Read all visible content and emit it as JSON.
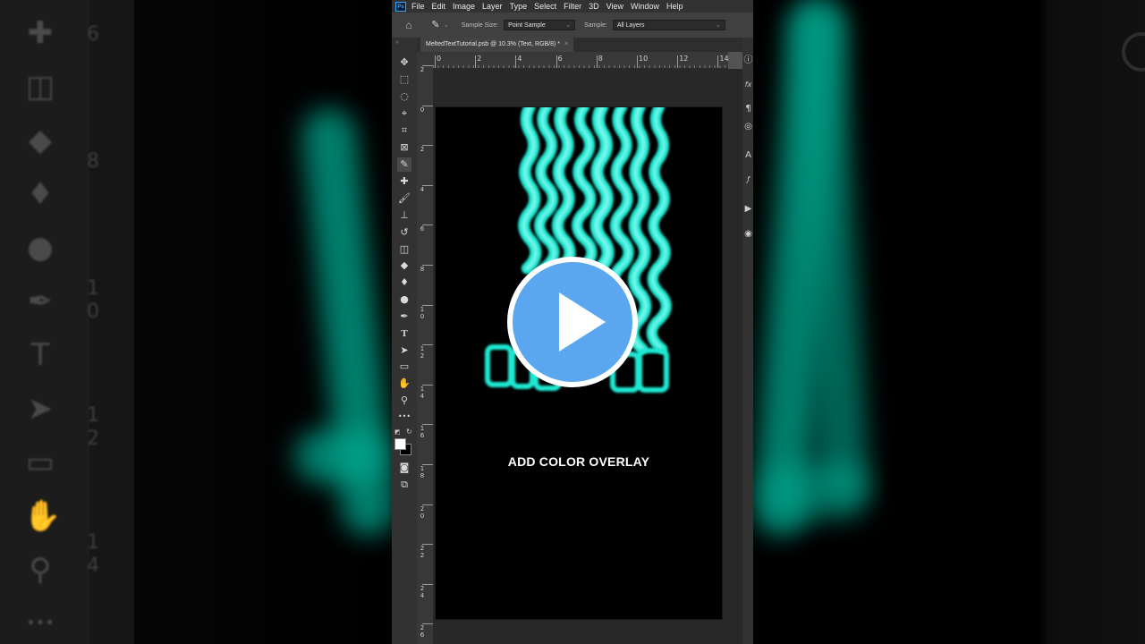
{
  "menu": {
    "logo": "Ps",
    "items": [
      "File",
      "Edit",
      "Image",
      "Layer",
      "Type",
      "Select",
      "Filter",
      "3D",
      "View",
      "Window",
      "Help"
    ]
  },
  "options_bar": {
    "home_icon": "home-icon",
    "tool_icon": "eyedropper-icon",
    "sample_size_label": "Sample Size:",
    "sample_size_value": "Point Sample",
    "sample_label": "Sample:",
    "sample_value": "All Layers"
  },
  "document": {
    "tab_title": "MeltedTextTutorial.psb @ 10.3% (Text, RGB/8) *",
    "close": "×"
  },
  "ruler": {
    "horizontal": [
      "0",
      "2",
      "4",
      "6",
      "8",
      "10",
      "12",
      "14"
    ],
    "vertical": [
      {
        "digits": [
          "2"
        ]
      },
      {
        "digits": [
          "0"
        ]
      },
      {
        "digits": [
          "2"
        ]
      },
      {
        "digits": [
          "4"
        ]
      },
      {
        "digits": [
          "6"
        ]
      },
      {
        "digits": [
          "8"
        ]
      },
      {
        "digits": [
          "1",
          "0"
        ]
      },
      {
        "digits": [
          "1",
          "2"
        ]
      },
      {
        "digits": [
          "1",
          "4"
        ]
      },
      {
        "digits": [
          "1",
          "6"
        ]
      },
      {
        "digits": [
          "1",
          "8"
        ]
      },
      {
        "digits": [
          "2",
          "0"
        ]
      },
      {
        "digits": [
          "2",
          "2"
        ]
      },
      {
        "digits": [
          "2",
          "4"
        ]
      },
      {
        "digits": [
          "2",
          "6"
        ]
      }
    ]
  },
  "tools": [
    {
      "name": "move-tool-icon",
      "glyph": "✥"
    },
    {
      "name": "marquee-tool-icon",
      "glyph": "⬚"
    },
    {
      "name": "lasso-tool-icon",
      "glyph": "◌"
    },
    {
      "name": "quick-selection-tool-icon",
      "glyph": "⌖"
    },
    {
      "name": "crop-tool-icon",
      "glyph": "⌗"
    },
    {
      "name": "frame-tool-icon",
      "glyph": "⊠"
    },
    {
      "name": "eyedropper-tool-icon",
      "glyph": "✎"
    },
    {
      "name": "healing-brush-tool-icon",
      "glyph": "✚"
    },
    {
      "name": "brush-tool-icon",
      "glyph": "🖌"
    },
    {
      "name": "clone-stamp-tool-icon",
      "glyph": "⊥"
    },
    {
      "name": "history-brush-tool-icon",
      "glyph": "↺"
    },
    {
      "name": "eraser-tool-icon",
      "glyph": "◫"
    },
    {
      "name": "paint-bucket-tool-icon",
      "glyph": "◆"
    },
    {
      "name": "blur-tool-icon",
      "glyph": "♦"
    },
    {
      "name": "dodge-tool-icon",
      "glyph": "●"
    },
    {
      "name": "pen-tool-icon",
      "glyph": "✒"
    },
    {
      "name": "type-tool-icon",
      "glyph": "T"
    },
    {
      "name": "path-selection-tool-icon",
      "glyph": "➤"
    },
    {
      "name": "rectangle-tool-icon",
      "glyph": "▭"
    },
    {
      "name": "hand-tool-icon",
      "glyph": "✋"
    },
    {
      "name": "zoom-tool-icon",
      "glyph": "⚲"
    },
    {
      "name": "more-tools-icon",
      "glyph": "•••"
    }
  ],
  "right_panel_icons": [
    {
      "name": "info-icon",
      "glyph": "ⓘ"
    },
    {
      "name": "fx-icon",
      "glyph": "fx"
    },
    {
      "name": "paragraph-icon",
      "glyph": "¶"
    },
    {
      "name": "layers-icon",
      "glyph": "◎"
    },
    {
      "name": "character-icon",
      "glyph": "A"
    },
    {
      "name": "glyphs-icon",
      "glyph": "ƒ"
    },
    {
      "name": "play-action-icon",
      "glyph": "▶"
    },
    {
      "name": "libraries-icon",
      "glyph": "◉"
    }
  ],
  "canvas": {
    "caption": "ADD COLOR OVERLAY",
    "melt_color": "#1de9d2"
  },
  "video": {
    "play_button_color": "#5aa7ef",
    "play_icon": "play-icon"
  },
  "backdrop": {
    "ruler_numbers": [
      "6",
      "8",
      "1",
      "0",
      "1",
      "2",
      "1",
      "4"
    ],
    "icons": [
      {
        "name": "bg-healing-icon",
        "glyph": "✚"
      },
      {
        "name": "bg-eraser-icon",
        "glyph": "◫"
      },
      {
        "name": "bg-bucket-icon",
        "glyph": "◆"
      },
      {
        "name": "bg-blur-icon",
        "glyph": "♦"
      },
      {
        "name": "bg-dodge-icon",
        "glyph": "●"
      },
      {
        "name": "bg-pen-icon",
        "glyph": "✒"
      },
      {
        "name": "bg-type-icon",
        "glyph": "T"
      },
      {
        "name": "bg-select-icon",
        "glyph": "➤"
      },
      {
        "name": "bg-rect-icon",
        "glyph": "▭"
      },
      {
        "name": "bg-hand-icon",
        "glyph": "✋"
      },
      {
        "name": "bg-zoom-icon",
        "glyph": "⚲"
      },
      {
        "name": "bg-more-icon",
        "glyph": "•••"
      }
    ]
  }
}
